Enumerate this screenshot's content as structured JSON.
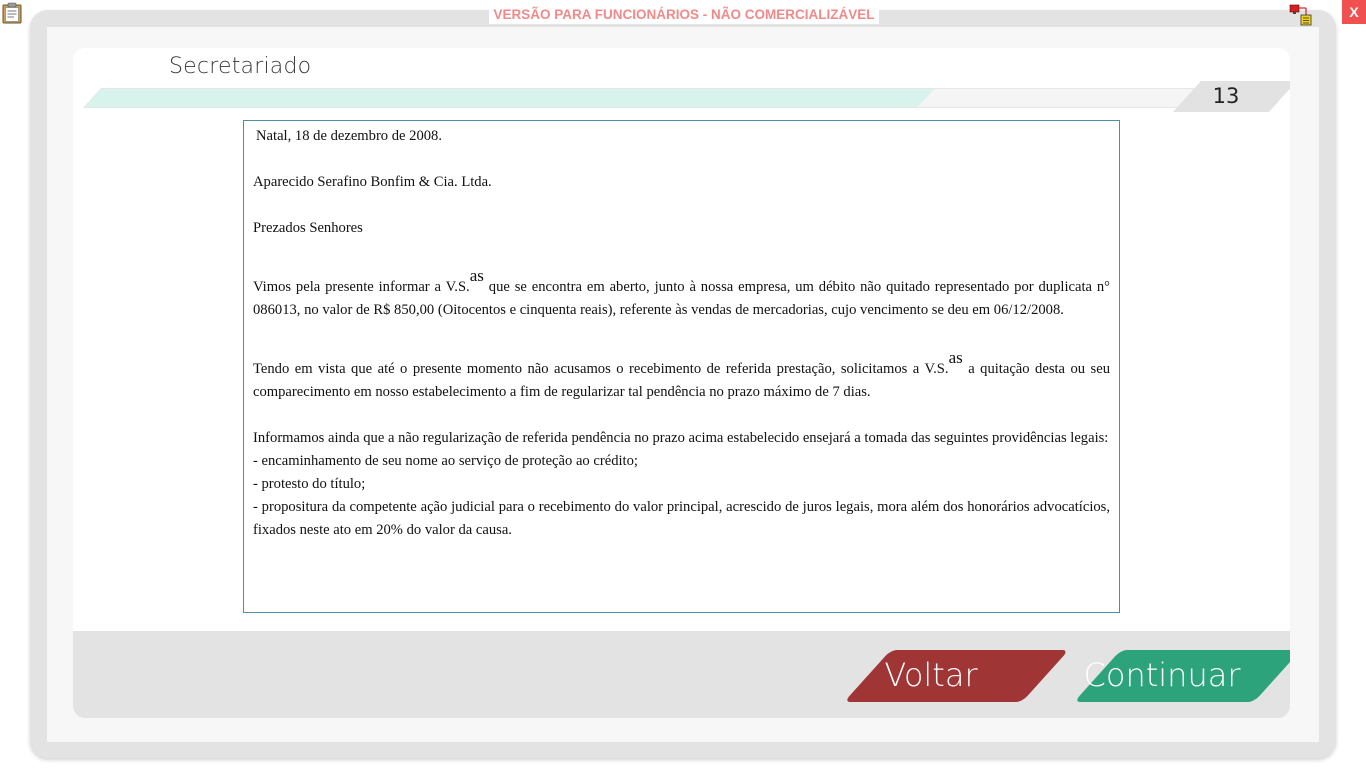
{
  "watermark": "VERSÃO PARA FUNCIONÁRIOS - NÃO COMERCIALIZÁVEL",
  "close_label": "X",
  "section_title": "Secretariado",
  "page_number": "13",
  "progress_fraction": 0.75,
  "letter": {
    "date_line": "Natal, 18 de dezembro de 2008.",
    "addressee": "Aparecido Serafino Bonfim & Cia. Ltda.",
    "salutation": "Prezados Senhores",
    "p1_a": "Vimos pela presente informar a V.S.",
    "p1_sup": "as",
    "p1_b": " que se encontra em aberto, junto à nossa empresa, um débito não quitado representado por duplicata n° 086013, no valor de R$ 850,00 (Oitocentos e cinquenta reais), referente às vendas de mercadorias, cujo vencimento se deu em 06/12/2008.",
    "p2_a": "Tendo em vista que até o presente momento não acusamos o recebimento de referida prestação, solicitamos a V.S.",
    "p2_sup": "as",
    "p2_b": " a quitação desta ou seu comparecimento em nosso estabelecimento a fim de regularizar tal pendência no prazo máximo de 7 dias.",
    "p3": "Informamos ainda que a não regularização de referida pendência no prazo acima estabelecido ensejará a tomada das seguintes providências legais:",
    "item1": " - encaminhamento de seu nome ao serviço de proteção ao crédito;",
    "item2": "- protesto do título;",
    "item3": "- propositura da competente ação judicial para o recebimento do valor principal, acrescido de juros legais, mora além dos honorários advocatícios, fixados neste ato em 20% do valor da causa."
  },
  "buttons": {
    "back": "Voltar",
    "next": "Continuar"
  },
  "colors": {
    "back_button": "#a03536",
    "next_button": "#2ca37a",
    "progress_fill": "#d8f3eb",
    "watermark_text": "#f08a8a",
    "close_button": "#f05050"
  },
  "icons": [
    "clipboard-icon",
    "network-icon"
  ]
}
